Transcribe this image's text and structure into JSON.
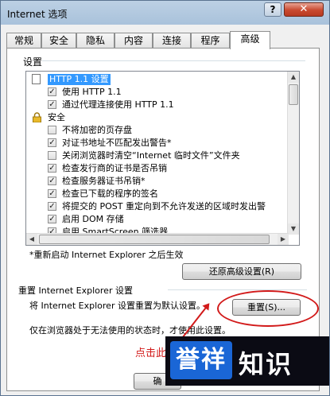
{
  "window": {
    "title": "Internet 选项",
    "help": "?",
    "close": "✕"
  },
  "tabs": [
    "常规",
    "安全",
    "隐私",
    "内容",
    "连接",
    "程序",
    "高级"
  ],
  "settings_group": "设置",
  "settings_items": [
    {
      "label": "HTTP 1.1 设置",
      "kind": "header-page",
      "highlighted": true
    },
    {
      "label": "使用 HTTP 1.1",
      "kind": "checkbox",
      "checked": true
    },
    {
      "label": "通过代理连接使用 HTTP 1.1",
      "kind": "checkbox",
      "checked": true
    },
    {
      "label": "安全",
      "kind": "header-lock"
    },
    {
      "label": "不将加密的页存盘",
      "kind": "checkbox",
      "checked": false
    },
    {
      "label": "对证书地址不匹配发出警告*",
      "kind": "checkbox",
      "checked": true
    },
    {
      "label": "关闭浏览器时清空“Internet 临时文件”文件夹",
      "kind": "checkbox",
      "checked": false
    },
    {
      "label": "检查发行商的证书是否吊销",
      "kind": "checkbox",
      "checked": true
    },
    {
      "label": "检查服务器证书吊销*",
      "kind": "checkbox",
      "checked": true
    },
    {
      "label": "检查已下载的程序的签名",
      "kind": "checkbox",
      "checked": true
    },
    {
      "label": "将提交的 POST 重定向到不允许发送的区域时发出警",
      "kind": "checkbox",
      "checked": true
    },
    {
      "label": "启用 DOM 存储",
      "kind": "checkbox",
      "checked": true
    },
    {
      "label": "启用 SmartScreen 筛选器",
      "kind": "checkbox",
      "checked": true
    }
  ],
  "restart_note": "*重新启动 Internet Explorer 之后生效",
  "restore_button": "还原高级设置(R)",
  "reset_group": "重置 Internet Explorer 设置",
  "reset_description": "将 Internet Explorer 设置重置为默认设置。",
  "reset_button": "重置(S)...",
  "reset_note": "仅在浏览器处于无法使用的状态时，才使用此设置。",
  "annotation_hint": "点击此",
  "ok_button_partial": "确",
  "watermark": {
    "badge": "誉祥",
    "text": "知识"
  },
  "colors": {
    "accent_red": "#d21a1a",
    "selection": "#3399ff",
    "watermark_blue": "#1a66d6"
  }
}
